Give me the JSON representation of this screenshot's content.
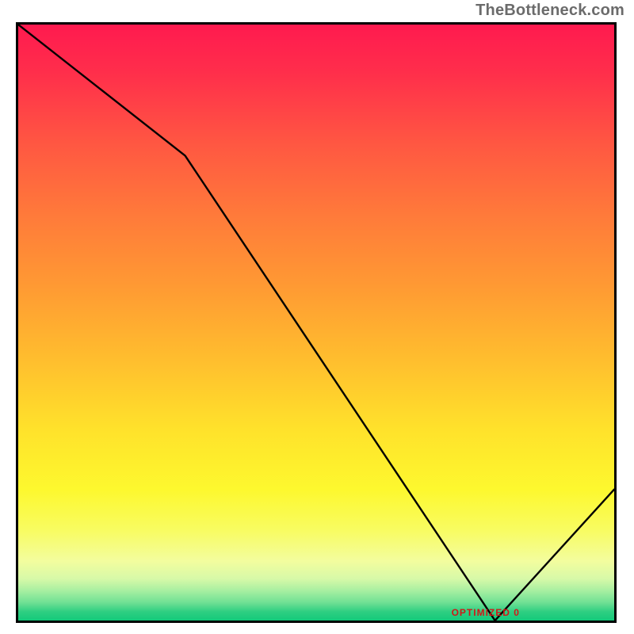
{
  "watermark": "TheBottleneck.com",
  "annotation_text": "OPTIMIZED 0",
  "chart_data": {
    "type": "line",
    "title": "",
    "xlabel": "",
    "ylabel": "",
    "xlim": [
      0,
      100
    ],
    "ylim": [
      0,
      100
    ],
    "background": "rainbow-gradient (red top → green bottom)",
    "series": [
      {
        "name": "curve",
        "x": [
          0,
          28,
          80,
          100
        ],
        "y": [
          100,
          78,
          0,
          22
        ]
      }
    ],
    "annotations": [
      {
        "text": "OPTIMIZED 0",
        "x": 80,
        "y": 0.7,
        "color": "#d01818"
      }
    ]
  },
  "colors": {
    "frame": "#000000",
    "curve": "#000000",
    "annotation": "#d01818",
    "watermark": "#6b6b6b"
  }
}
